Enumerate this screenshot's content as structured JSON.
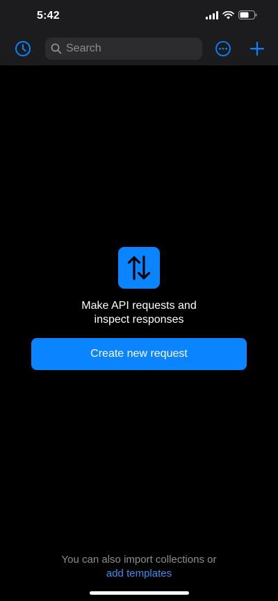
{
  "status_bar": {
    "time": "5:42"
  },
  "toolbar": {
    "history_icon": "history-clock-icon",
    "search": {
      "placeholder": "Search",
      "value": ""
    },
    "more_icon": "ellipsis-circle-icon",
    "add_icon": "plus-icon"
  },
  "empty_state": {
    "icon": "up-down-arrows-icon",
    "line1": "Make API requests and",
    "line2": "inspect responses",
    "button_label": "Create new request"
  },
  "footer": {
    "text": "You can also import collections or",
    "link": "add templates"
  },
  "colors": {
    "accent": "#0a84ff",
    "background": "#000000",
    "header": "#1c1c1e",
    "muted_text": "#8e8e93"
  }
}
